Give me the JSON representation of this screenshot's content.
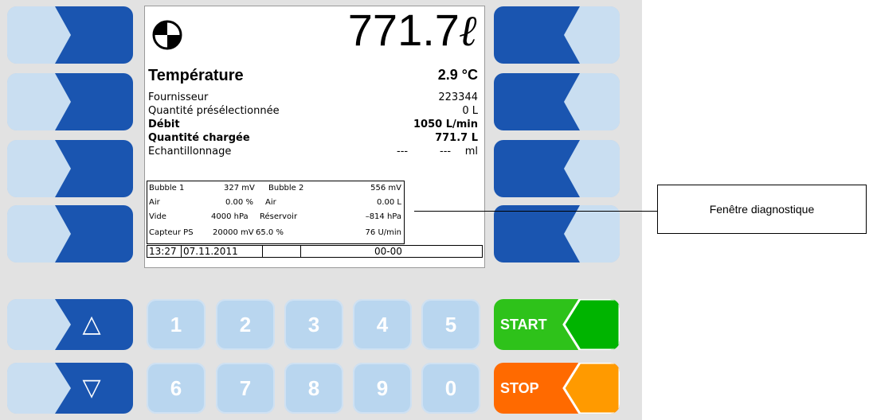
{
  "screen": {
    "volume": "771.7",
    "volume_unit": "ℓ",
    "title": "Température",
    "title_value": "2.9 °C",
    "rows": [
      {
        "label": "Fournisseur",
        "value": "223344",
        "bold": false
      },
      {
        "label": "Quantité présélectionnée",
        "value": "0 L",
        "bold": false
      },
      {
        "label": "Débit",
        "value": "1050 L/min",
        "bold": true
      },
      {
        "label": "Quantité chargée",
        "value": "771.7 L",
        "bold": true
      },
      {
        "label": "Echantillonnage",
        "value1": "---",
        "value2": "---",
        "value3": "ml",
        "bold": false
      }
    ],
    "diagnostic": {
      "r1c1": "Bubble 1",
      "r1c2": "327 mV",
      "r1c3": "Bubble 2",
      "r1c4": "556 mV",
      "r2c1": "Air",
      "r2c2": "0.00 %",
      "r2c3": "Air",
      "r2c4": "0.00 L",
      "r3c1": "Vide",
      "r3c2": "4000 hPa",
      "r3c3": "Réservoir",
      "r3c4": "–814 hPa",
      "r4c1": "Capteur PS",
      "r4c2": "20000 mV",
      "r4c3": "65.0 %",
      "r4c4": "76 U/min"
    },
    "status": {
      "time": "13:27",
      "date": "07.11.2011",
      "cell3": "",
      "code": "00-00"
    }
  },
  "callout": {
    "label": "Fenêtre diagnostique"
  },
  "keypad": {
    "numbers_top": [
      "1",
      "2",
      "3",
      "4",
      "5"
    ],
    "numbers_bottom": [
      "6",
      "7",
      "8",
      "9",
      "0"
    ],
    "start": "START",
    "stop": "STOP",
    "up_icon": "△",
    "down_icon": "▽"
  },
  "colors": {
    "key_dark": "#1a55b0",
    "key_light": "#c9def1",
    "start_green": "#2ec21a",
    "start_accent": "#00b400",
    "stop_orange": "#ff6a00",
    "stop_accent": "#ff9a00"
  }
}
